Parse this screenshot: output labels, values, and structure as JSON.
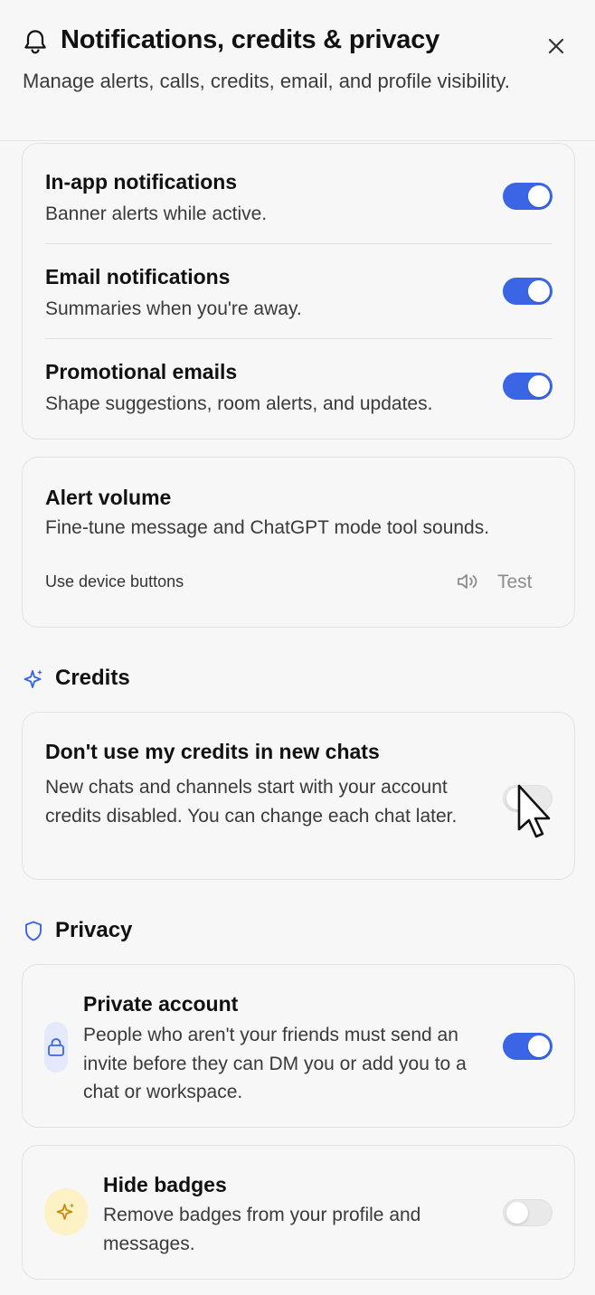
{
  "header": {
    "title": "Notifications, credits & privacy",
    "subtitle": "Manage alerts, calls, credits, email, and profile visibility."
  },
  "notifications": {
    "items": [
      {
        "title": "In-app notifications",
        "desc": "Banner alerts while active.",
        "enabled": true
      },
      {
        "title": "Email notifications",
        "desc": "Summaries when you're away.",
        "enabled": true
      },
      {
        "title": "Promotional emails",
        "desc": "Shape suggestions, room alerts, and updates.",
        "enabled": true
      }
    ]
  },
  "alert_volume": {
    "title": "Alert volume",
    "desc": "Fine-tune message and ChatGPT mode tool sounds.",
    "device_label": "Use device buttons",
    "test_label": "Test"
  },
  "credits": {
    "section_title": "Credits",
    "item": {
      "title": "Don't use my credits in new chats",
      "desc": "New chats and channels start with your account credits disabled. You can change each chat later.",
      "enabled": false
    }
  },
  "privacy": {
    "section_title": "Privacy",
    "private_account": {
      "title": "Private account",
      "desc": "People who aren't your friends must send an invite before they can DM you or add you to a chat or workspace.",
      "enabled": true
    },
    "hide_badges": {
      "title": "Hide badges",
      "desc": "Remove badges from your profile and messages.",
      "enabled": false
    }
  },
  "colors": {
    "accent": "#3a66e6",
    "toggle_off": "#e9e9e9",
    "lock_badge_bg": "#e4e9fb",
    "sparkle_badge_bg": "#fdf2c6"
  },
  "icons": {
    "header": "bell-icon",
    "close": "close-icon",
    "volume": "speaker-icon",
    "credits": "sparkle-icon",
    "privacy": "shield-icon",
    "private_account": "lock-icon",
    "hide_badges": "sparkle-icon"
  }
}
